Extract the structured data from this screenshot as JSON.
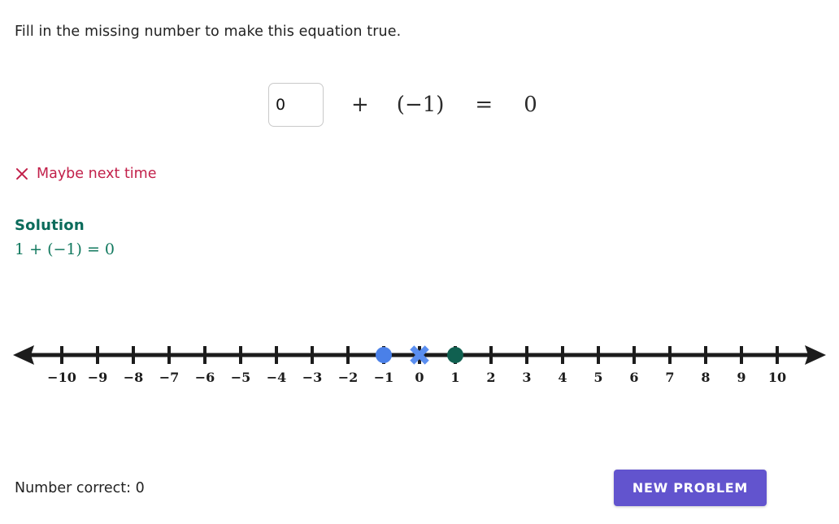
{
  "prompt": "Fill in the missing number to make this equation true.",
  "equation": {
    "input_value": "0",
    "input_placeholder": "",
    "operator": "+",
    "operand": "(−1)",
    "equals": "=",
    "result": "0"
  },
  "feedback": {
    "icon": "close-x-icon",
    "text": "Maybe next time",
    "color": "#c2204a"
  },
  "solution": {
    "heading": "Solution",
    "equation": "1 + (−1) = 0",
    "color": "#0b6b5b"
  },
  "footer": {
    "score_label": "Number correct: 0",
    "new_problem_label": "NEW PROBLEM",
    "button_color": "#6254ce"
  },
  "chart_data": {
    "type": "number-line",
    "title": "",
    "xlabel": "",
    "ylabel": "",
    "xlim": [
      -10,
      10
    ],
    "tick_step": 1,
    "grid": false,
    "arrows": [
      "left",
      "right"
    ],
    "tick_labels": [
      "−10",
      "−9",
      "−8",
      "−7",
      "−6",
      "−5",
      "−4",
      "−3",
      "−2",
      "−1",
      "0",
      "1",
      "2",
      "3",
      "4",
      "5",
      "6",
      "7",
      "8",
      "9",
      "10"
    ],
    "tick_values": [
      -10,
      -9,
      -8,
      -7,
      -6,
      -5,
      -4,
      -3,
      -2,
      -1,
      0,
      1,
      2,
      3,
      4,
      5,
      6,
      7,
      8,
      9,
      10
    ],
    "markers": [
      {
        "name": "start-point",
        "value": -1,
        "shape": "circle",
        "color": "#4a80e8"
      },
      {
        "name": "entered-answer-point",
        "value": 0,
        "shape": "x",
        "color": "#5a8ef0"
      },
      {
        "name": "solution-point",
        "value": 1,
        "shape": "circle",
        "color": "#106050"
      }
    ],
    "axis_color": "#1c1c1c"
  }
}
